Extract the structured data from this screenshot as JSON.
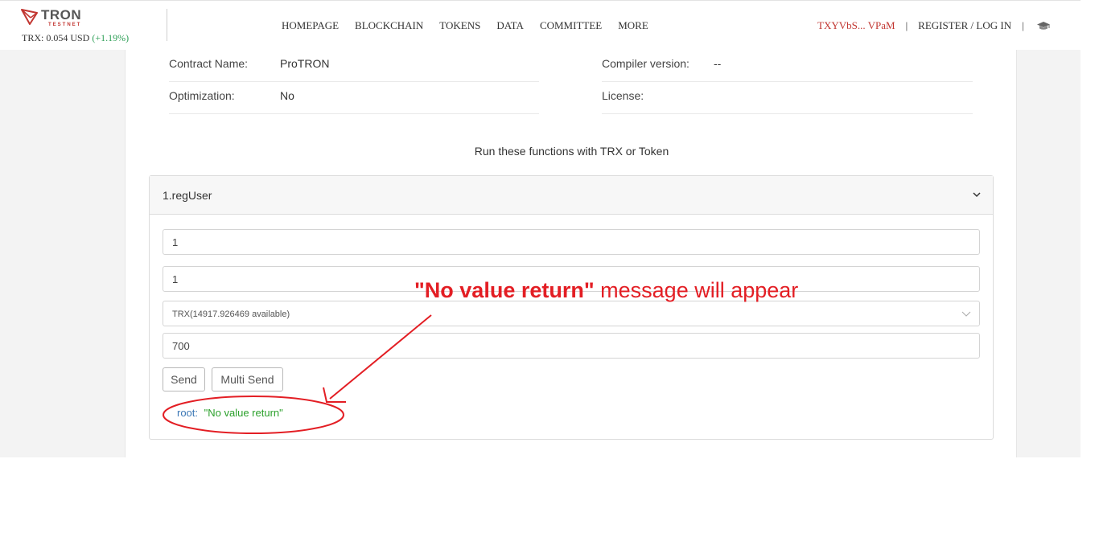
{
  "header": {
    "logo_word": "TRON",
    "logo_sub": "TESTNET",
    "price_text": "TRX: 0.054 USD",
    "price_change": "(+1.19%)",
    "nav": [
      "HOMEPAGE",
      "BLOCKCHAIN",
      "TOKENS",
      "DATA",
      "COMMITTEE",
      "MORE"
    ],
    "account_address": "TXYVbS... VPaM",
    "separator": "|",
    "register_label": "REGISTER / LOG IN",
    "academy_icon": "graduation-cap-icon"
  },
  "contract_info": {
    "name_label": "Contract Name:",
    "name_value": "ProTRON",
    "optimization_label": "Optimization:",
    "optimization_value": "No",
    "compiler_label": "Compiler version:",
    "compiler_value": "--",
    "license_label": "License:",
    "license_value": ""
  },
  "functions": {
    "run_title": "Run these functions with TRX or Token",
    "items": [
      {
        "title": "1.regUser",
        "inputs": [
          "1",
          "1"
        ],
        "token_select": "TRX(14917.926469 available)",
        "amount": "700",
        "send_label": "Send",
        "multi_send_label": "Multi Send",
        "result_key": "root:",
        "result_value": "\"No value return\""
      }
    ]
  },
  "annotation": {
    "bold_part": "\"No value return\"",
    "rest": " message will appear",
    "color": "#e31e24"
  },
  "colors": {
    "brand_red": "#c23631",
    "positive_green": "#2e9f57",
    "page_gray": "#f3f3f3"
  }
}
